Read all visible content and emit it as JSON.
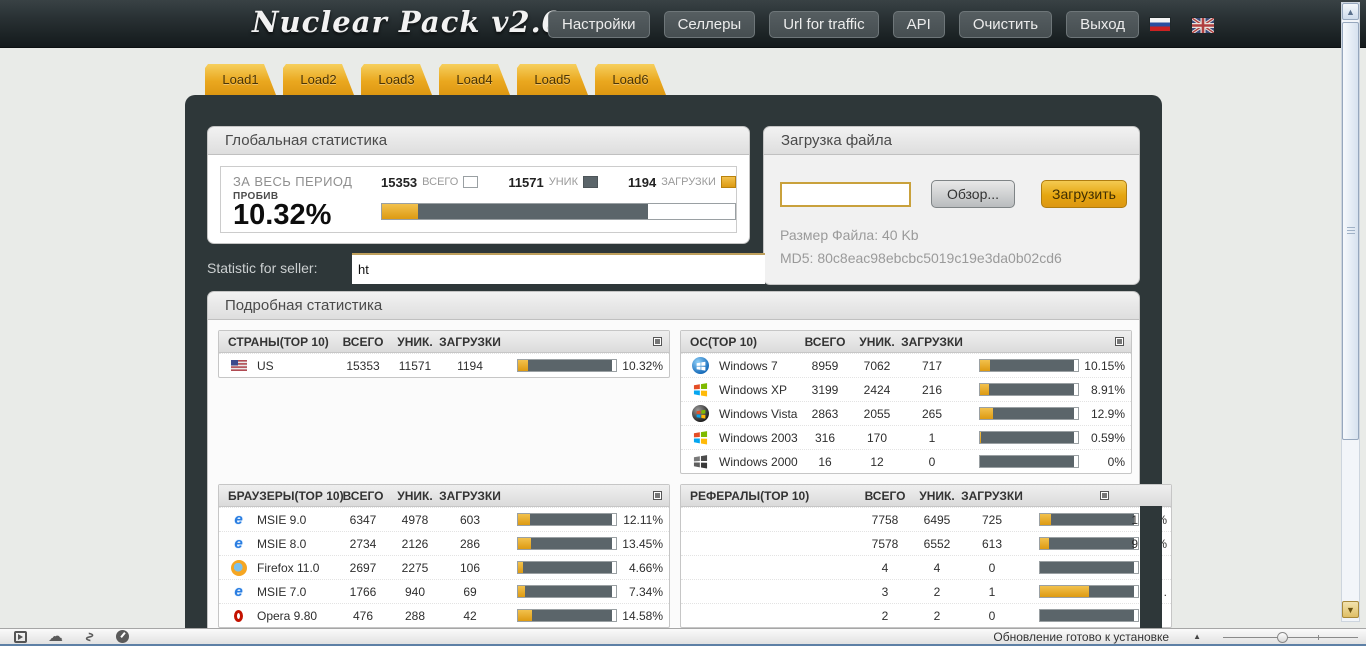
{
  "topbar": {
    "logo": "Nuclear Pack v2.0",
    "nav": [
      {
        "label": "Настройки"
      },
      {
        "label": "Селлеры"
      },
      {
        "label": "Url for traffic"
      },
      {
        "label": "API"
      },
      {
        "label": "Очистить"
      },
      {
        "label": "Выход"
      }
    ]
  },
  "tabs": [
    {
      "label": "Load1"
    },
    {
      "label": "Load2"
    },
    {
      "label": "Load3"
    },
    {
      "label": "Load4"
    },
    {
      "label": "Load5"
    },
    {
      "label": "Load6"
    }
  ],
  "global_stats": {
    "title": "Глобальная статистика",
    "period_label": "ЗА ВЕСЬ ПЕРИОД",
    "hit_label": "ПРОБИВ",
    "hit_value": "10.32%",
    "legend": [
      {
        "value": "15353",
        "label": "ВСЕГО"
      },
      {
        "value": "11571",
        "label": "УНИК"
      },
      {
        "value": "1194",
        "label": "ЗАГРУЗКИ"
      }
    ],
    "bar_gold": "10.32%",
    "bar_gray": "75.4%"
  },
  "seller": {
    "label": "Statistic for seller:",
    "value": "ht"
  },
  "upload": {
    "title": "Загрузка файла",
    "file_value": "",
    "browse_label": "Обзор...",
    "upload_label": "Загрузить",
    "file_size": "Размер Файла: 40 Kb",
    "md5": "MD5: 80c8eac98ebcbc5019c19e3da0b02cd6"
  },
  "detailed": {
    "title": "Подробная статистика",
    "columns": [
      "ВСЕГО",
      "УНИК.",
      "ЗАГРУЗКИ"
    ],
    "countries": {
      "title": "СТРАНЫ(ТОР 10)",
      "rows": [
        {
          "name": "US",
          "total": "15353",
          "uniq": "11571",
          "loads": "1194",
          "pct": "10.32%",
          "gold": "10.32%"
        }
      ]
    },
    "os": {
      "title": "ОС(ТОР 10)",
      "rows": [
        {
          "name": "Windows 7",
          "total": "8959",
          "uniq": "7062",
          "loads": "717",
          "pct": "10.15%",
          "gold": "10.15%"
        },
        {
          "name": "Windows XP",
          "total": "3199",
          "uniq": "2424",
          "loads": "216",
          "pct": "8.91%",
          "gold": "8.91%"
        },
        {
          "name": "Windows Vista",
          "total": "2863",
          "uniq": "2055",
          "loads": "265",
          "pct": "12.9%",
          "gold": "12.9%"
        },
        {
          "name": "Windows 2003",
          "total": "316",
          "uniq": "170",
          "loads": "1",
          "pct": "0.59%",
          "gold": "0.6%"
        },
        {
          "name": "Windows 2000",
          "total": "16",
          "uniq": "12",
          "loads": "0",
          "pct": "0%",
          "gold": "0%"
        }
      ]
    },
    "browsers": {
      "title": "БРАУЗЕРЫ(ТОР 10)",
      "rows": [
        {
          "name": "MSIE 9.0",
          "total": "6347",
          "uniq": "4978",
          "loads": "603",
          "pct": "12.11%",
          "gold": "12.11%"
        },
        {
          "name": "MSIE 8.0",
          "total": "2734",
          "uniq": "2126",
          "loads": "286",
          "pct": "13.45%",
          "gold": "13.45%"
        },
        {
          "name": "Firefox 11.0",
          "total": "2697",
          "uniq": "2275",
          "loads": "106",
          "pct": "4.66%",
          "gold": "4.66%"
        },
        {
          "name": "MSIE 7.0",
          "total": "1766",
          "uniq": "940",
          "loads": "69",
          "pct": "7.34%",
          "gold": "7.34%"
        },
        {
          "name": "Opera 9.80",
          "total": "476",
          "uniq": "288",
          "loads": "42",
          "pct": "14.58%",
          "gold": "14.58%"
        }
      ]
    },
    "referrers": {
      "title": "РЕФЕРАЛЫ(ТОР 10)",
      "rows": [
        {
          "name": "",
          "total": "7758",
          "uniq": "6495",
          "loads": "725",
          "pct_left": "1",
          "pct_right": "%",
          "gold": "11%"
        },
        {
          "name": "",
          "total": "7578",
          "uniq": "6552",
          "loads": "613",
          "pct_left": "9",
          "pct_right": "%",
          "gold": "9.4%"
        },
        {
          "name": "",
          "total": "4",
          "uniq": "4",
          "loads": "0",
          "pct_left": "",
          "pct_right": "",
          "gold": "0%"
        },
        {
          "name": "",
          "total": "3",
          "uniq": "2",
          "loads": "1",
          "pct_left": "",
          "pct_right": ".",
          "gold": "50%"
        },
        {
          "name": "",
          "total": "2",
          "uniq": "2",
          "loads": "0",
          "pct_left": "",
          "pct_right": "",
          "gold": "0%"
        }
      ]
    }
  },
  "statusbar": {
    "update_text": "Обновление готово к установке"
  },
  "colors": {
    "accent_gold": "#e5a611",
    "panel_dark": "#2e3739",
    "bar_gray": "#5b656a",
    "page_bg": "#e9ebe8"
  }
}
